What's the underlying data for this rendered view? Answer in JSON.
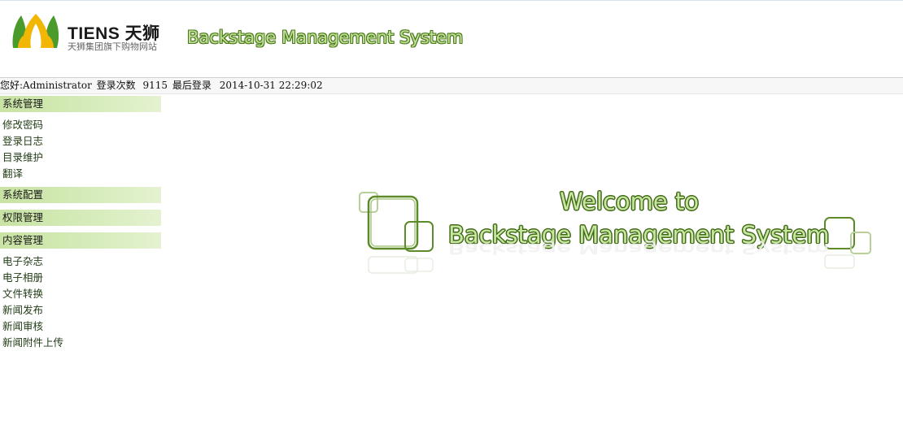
{
  "brand": {
    "logo_name": "TIENS 天狮",
    "logo_subtitle": "天狮集团旗下购物网站",
    "system_title": "Backstage Management System"
  },
  "status": {
    "greeting": "您好:Administrator",
    "login_count_label": "登录次数",
    "login_count": "9115",
    "last_login_label": "最后登录",
    "last_login_time": "2014-10-31 22:29:02"
  },
  "sidebar": {
    "system_management": {
      "label": "系统管理",
      "items": [
        "修改密码",
        "登录日志",
        "目录维护",
        "翻译"
      ]
    },
    "system_config": {
      "label": "系统配置"
    },
    "permission_management": {
      "label": "权限管理"
    },
    "content_management": {
      "label": "内容管理",
      "items": [
        "电子杂志",
        "电子相册",
        "文件转换",
        "新闻发布",
        "新闻审核",
        "新闻附件上传"
      ]
    }
  },
  "welcome": {
    "line1": "Welcome to",
    "line2": "Backstage Management System"
  },
  "colors": {
    "accent_green": "#c8e3a4",
    "title_outline": "#4c7a18",
    "logo_yellow": "#f2b705",
    "logo_green": "#4a9a2c"
  },
  "icons": {
    "logo": "tiens-leaf-logo-icon",
    "welcome_decor": "rounded-squares-decoration"
  }
}
